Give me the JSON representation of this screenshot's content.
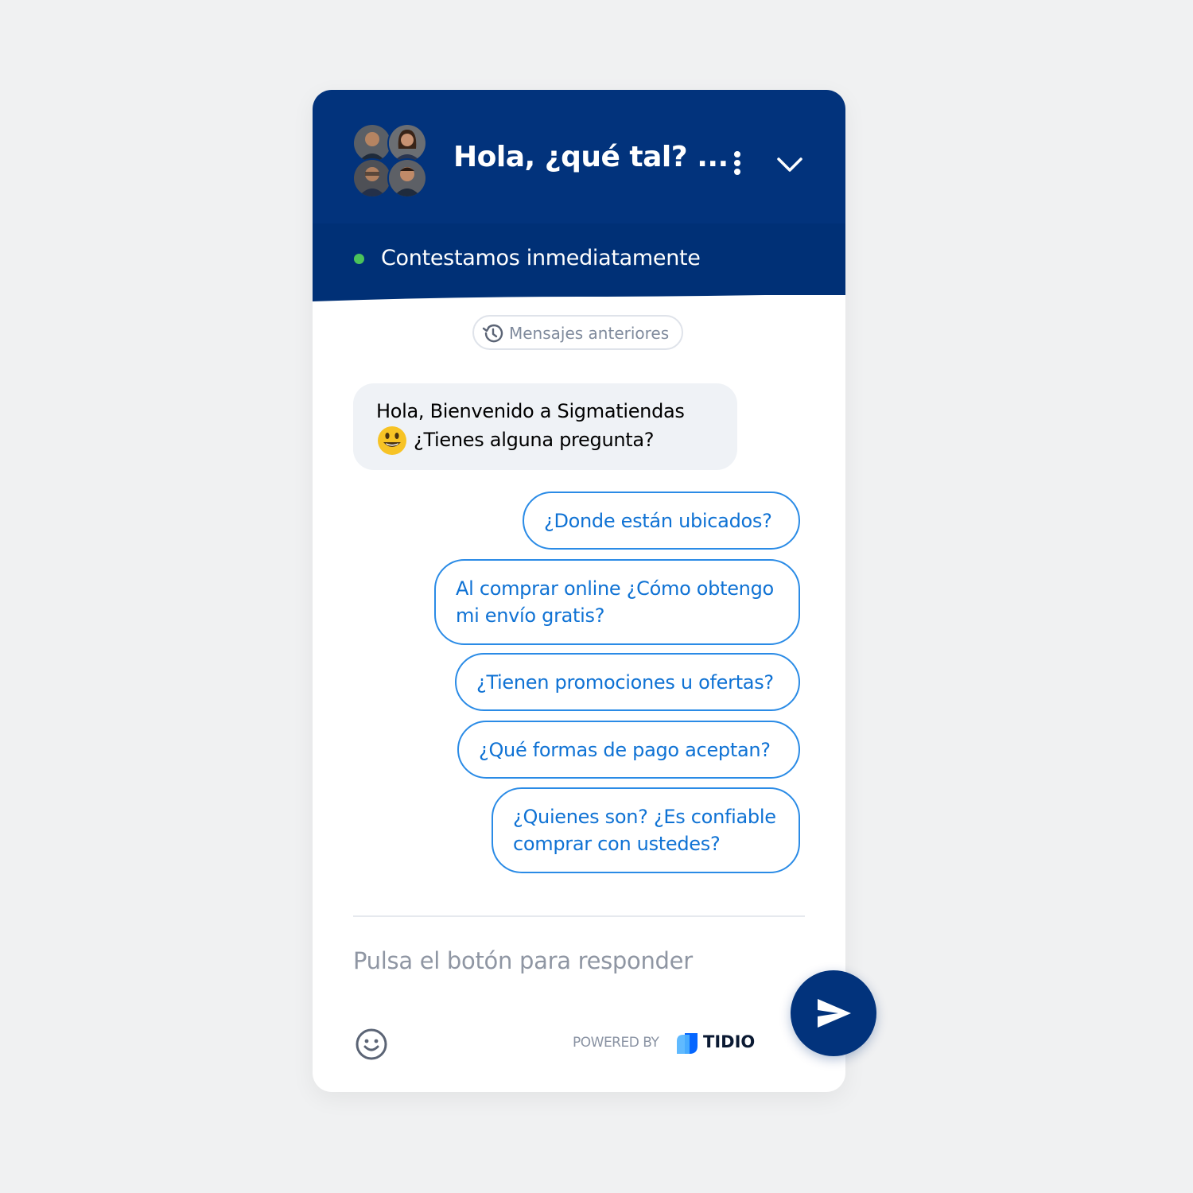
{
  "header": {
    "title": "Hola, ¿qué tal? ...",
    "status_text": "Contestamos inmediatamente",
    "menu_icon": "more-vertical-icon",
    "collapse_icon": "chevron-down-icon"
  },
  "history": {
    "label": "Mensajes anteriores",
    "icon": "history-icon"
  },
  "bot_message": {
    "line1": "Hola, Bienvenido a Sigmatiendas",
    "line2": "¿Tienes alguna pregunta?",
    "emoji": "smiley-emoji"
  },
  "quick_replies": [
    {
      "lines": [
        "¿Donde están ubicados?"
      ]
    },
    {
      "lines": [
        "Al comprar online ¿Cómo obtengo",
        "mi envío gratis?"
      ]
    },
    {
      "lines": [
        "¿Tienen promociones u ofertas?"
      ]
    },
    {
      "lines": [
        "¿Qué formas de pago aceptan?"
      ]
    },
    {
      "lines": [
        "¿Quienes son? ¿Es confiable",
        "comprar con ustedes?"
      ]
    }
  ],
  "composer": {
    "placeholder": "Pulsa el botón para responder",
    "emoji_icon": "emoji-icon",
    "send_icon": "send-icon"
  },
  "branding": {
    "powered_by": "POWERED BY",
    "brand": "TIDIO"
  },
  "colors": {
    "header_bg": "#02337c",
    "status_green": "#4bc35a",
    "reply_border": "#2a8be6",
    "reply_text": "#0f72d4",
    "bot_bubble": "#eff2f6"
  }
}
